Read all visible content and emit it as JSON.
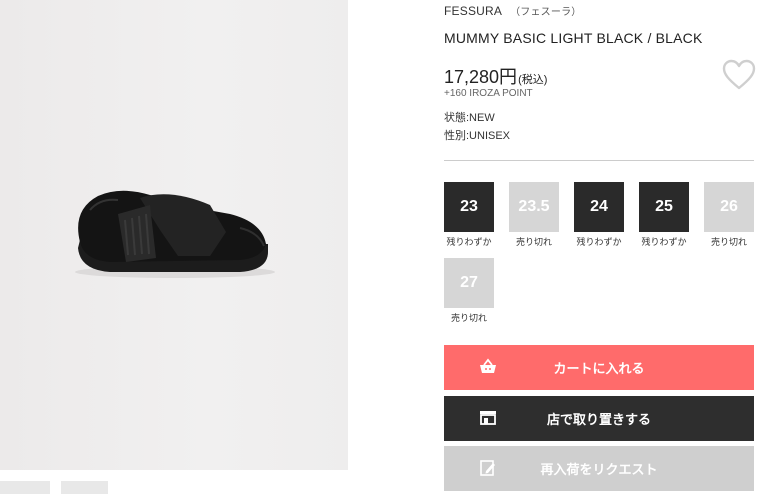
{
  "product": {
    "brand": "FESSURA",
    "brand_kana": "（フェスーラ）",
    "name": "MUMMY BASIC LIGHT BLACK / BLACK",
    "price": "17,280円",
    "tax_note": "(税込)",
    "points": "+160 IROZA POINT",
    "condition": "状態:NEW",
    "gender": "性別:UNISEX"
  },
  "sizes": [
    {
      "label": "23",
      "status": "残りわずか",
      "available": true
    },
    {
      "label": "23.5",
      "status": "売り切れ",
      "available": false
    },
    {
      "label": "24",
      "status": "残りわずか",
      "available": true
    },
    {
      "label": "25",
      "status": "残りわずか",
      "available": true
    },
    {
      "label": "26",
      "status": "売り切れ",
      "available": false
    },
    {
      "label": "27",
      "status": "売り切れ",
      "available": false
    }
  ],
  "actions": {
    "cart_label": "カートに入れる",
    "store_label": "店で取り置きする",
    "restock_label": "再入荷をリクエスト"
  },
  "colors": {
    "cart": "#ff6b6b",
    "store": "#2e2e2e",
    "restock": "#cfcfcf",
    "size_available": "#2a2a2a",
    "size_soldout": "#d6d6d6"
  },
  "icons": {
    "favorite": "heart-icon",
    "cart": "basket-icon",
    "store": "store-icon",
    "restock": "edit-icon"
  }
}
